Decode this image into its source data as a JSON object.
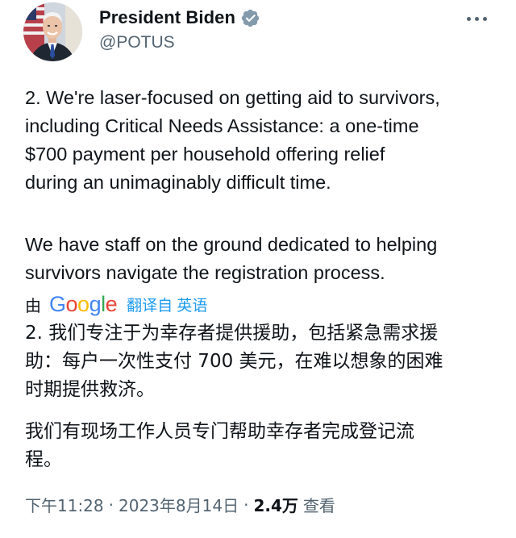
{
  "author": {
    "display_name": "President Biden",
    "handle": "@POTUS",
    "verified_icon": "verified-badge-icon"
  },
  "tweet": {
    "paragraph_1": "2. We're laser-focused on getting aid to survivors,\nincluding Critical Needs Assistance: a one-time\n$700 payment per household offering relief\nduring an unimaginably difficult time.",
    "paragraph_2": "We have staff on the ground dedicated to helping\nsurvivors navigate the registration process."
  },
  "translation": {
    "by_label": "由",
    "provider": "Google",
    "note": "翻译自 英语",
    "paragraph_1": "2. 我们专注于为幸存者提供援助，包括紧急需求援\n助：每户一次性支付 700 美元，在难以想象的困难\n时期提供救济。",
    "paragraph_2": "我们有现场工作人员专门帮助幸存者完成登记流\n程。"
  },
  "meta": {
    "time": "下午11:28",
    "separator": "·",
    "date": "2023年8月14日",
    "views_count": "2.4万",
    "views_label": "查看"
  },
  "colors": {
    "text": "#0f1419",
    "secondary": "#536471",
    "link": "#1d9bf0",
    "verified": "#829aab"
  }
}
